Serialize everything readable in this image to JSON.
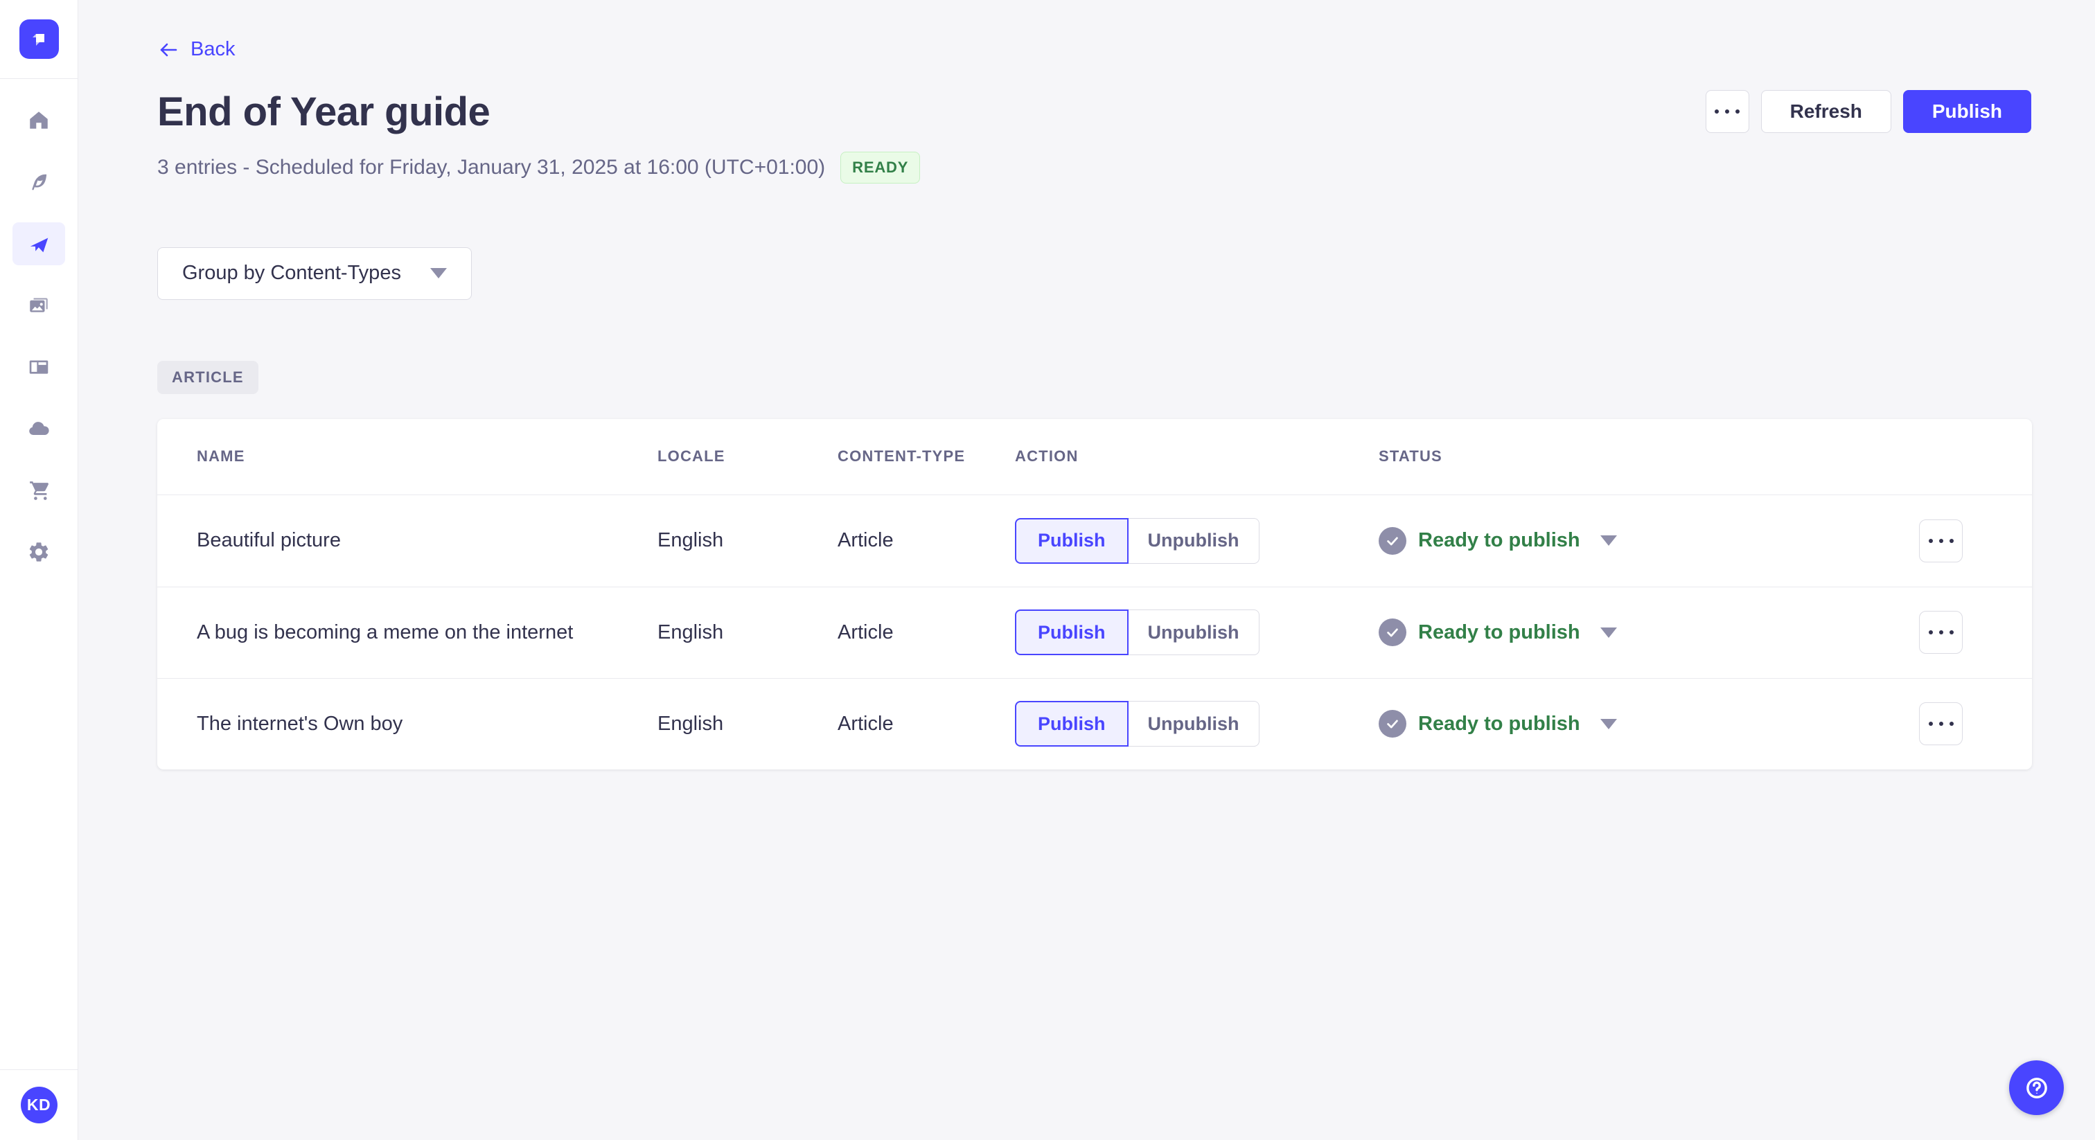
{
  "app": {
    "accent_color": "#4945FF",
    "success_color": "#328048",
    "background_color": "#F6F6F9"
  },
  "sidebar": {
    "logo_icon": "strapi-logo-icon",
    "items": [
      {
        "id": "home",
        "icon": "home-icon",
        "active": false
      },
      {
        "id": "content-manager",
        "icon": "feather-icon",
        "active": false
      },
      {
        "id": "releases",
        "icon": "paper-plane-icon",
        "active": true
      },
      {
        "id": "media-library",
        "icon": "media-library-icon",
        "active": false
      },
      {
        "id": "content-type-builder",
        "icon": "layout-icon",
        "active": false
      },
      {
        "id": "cloud",
        "icon": "cloud-icon",
        "active": false
      },
      {
        "id": "marketplace",
        "icon": "cart-icon",
        "active": false
      },
      {
        "id": "settings",
        "icon": "gear-icon",
        "active": false
      }
    ],
    "avatar_initials": "KD"
  },
  "header": {
    "back_label": "Back",
    "title": "End of Year guide",
    "subtitle": "3 entries - Scheduled for Friday, January 31, 2025 at 16:00 (UTC+01:00)",
    "status_badge": "READY"
  },
  "toolbar": {
    "refresh_label": "Refresh",
    "publish_label": "Publish",
    "more_icon": "ellipsis-icon"
  },
  "filters": {
    "group_by_label": "Group by Content-Types"
  },
  "group": {
    "label": "ARTICLE"
  },
  "table": {
    "columns": [
      "NAME",
      "LOCALE",
      "CONTENT-TYPE",
      "ACTION",
      "STATUS"
    ],
    "action_labels": {
      "publish": "Publish",
      "unpublish": "Unpublish"
    },
    "rows": [
      {
        "name": "Beautiful picture",
        "locale": "English",
        "content_type": "Article",
        "status": "Ready to publish"
      },
      {
        "name": "A bug is becoming a meme on the internet",
        "locale": "English",
        "content_type": "Article",
        "status": "Ready to publish"
      },
      {
        "name": "The internet's Own boy",
        "locale": "English",
        "content_type": "Article",
        "status": "Ready to publish"
      }
    ]
  },
  "help": {
    "icon": "help-icon"
  }
}
